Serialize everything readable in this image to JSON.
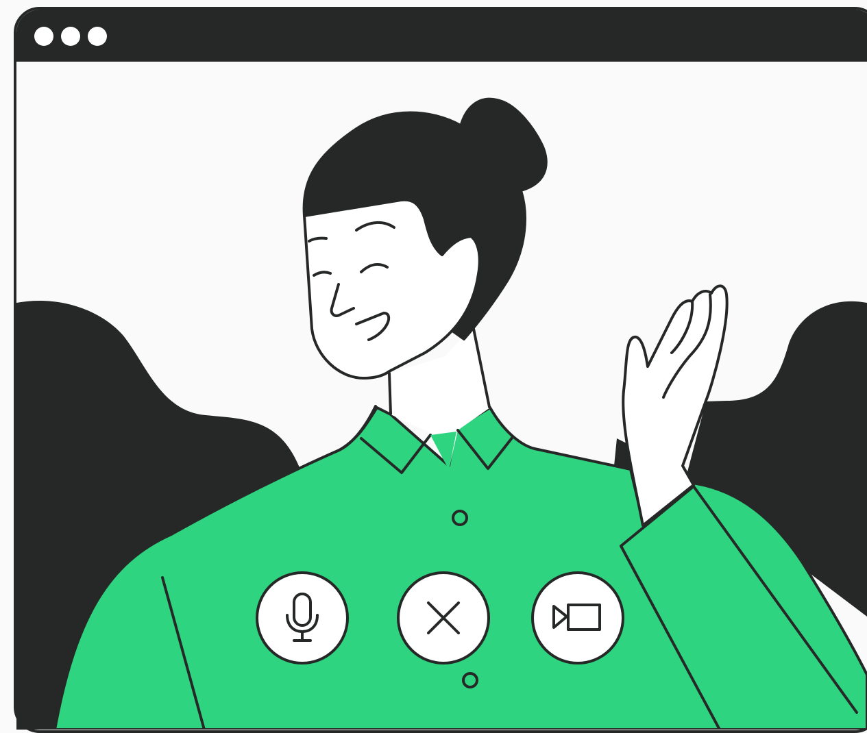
{
  "window": {
    "titlebar_dots": [
      "window-dot-1",
      "window-dot-2",
      "window-dot-3"
    ]
  },
  "call_controls": {
    "mute": {
      "icon": "microphone-icon"
    },
    "end": {
      "icon": "close-icon"
    },
    "camera": {
      "icon": "video-camera-icon"
    }
  },
  "colors": {
    "ink": "#262827",
    "screen": "#fafafa",
    "shirt": "#2ed47f",
    "skin": "#ffffff"
  }
}
